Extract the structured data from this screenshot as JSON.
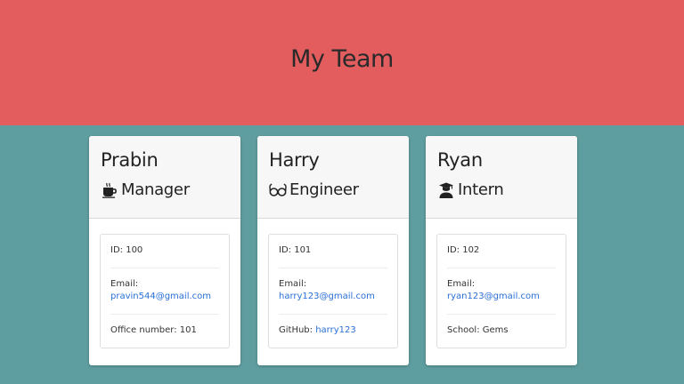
{
  "header": {
    "title": "My Team"
  },
  "employees": [
    {
      "name": "Prabin",
      "role": "Manager",
      "icon": "coffee-icon",
      "id_label": "ID: ",
      "id": "100",
      "email_label": "Email: ",
      "email": "pravin544@gmail.com",
      "extra_label": "Office number: ",
      "extra": "101"
    },
    {
      "name": "Harry",
      "role": "Engineer",
      "icon": "glasses-icon",
      "id_label": "ID: ",
      "id": "101",
      "email_label": "Email: ",
      "email": "harry123@gmail.com",
      "extra_label": "GitHub: ",
      "extra": "harry123"
    },
    {
      "name": "Ryan",
      "role": "Intern",
      "icon": "graduate-icon",
      "id_label": "ID: ",
      "id": "102",
      "email_label": "Email: ",
      "email": "ryan123@gmail.com",
      "extra_label": "School: ",
      "extra": "Gems"
    }
  ],
  "colors": {
    "header_bg": "#e35d5f",
    "page_bg": "#5f9ea0",
    "link": "#2a6fd6"
  }
}
